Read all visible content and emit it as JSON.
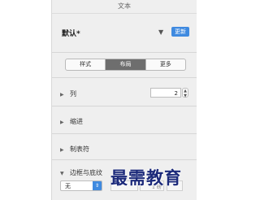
{
  "panel": {
    "title": "文本",
    "style_name": "默认*",
    "update_label": "更新",
    "tabs": [
      "样式",
      "布局",
      "更多"
    ],
    "active_tab": "布局"
  },
  "sections": {
    "columns": {
      "label": "列",
      "value": "2"
    },
    "indents": {
      "label": "缩进"
    },
    "tabs": {
      "label": "制表符"
    },
    "borders": {
      "label": "边框与底纹",
      "style_value": "无",
      "ghost_value": "1 磅"
    }
  },
  "watermark": "最需教育",
  "colors": {
    "accent": "#3f8ae0",
    "active_tab_bg": "#6e6e6e",
    "watermark": "#1c2a7a"
  },
  "icons": [
    "chevron-down-icon",
    "disclosure-triangle-icon",
    "stepper-icon"
  ]
}
